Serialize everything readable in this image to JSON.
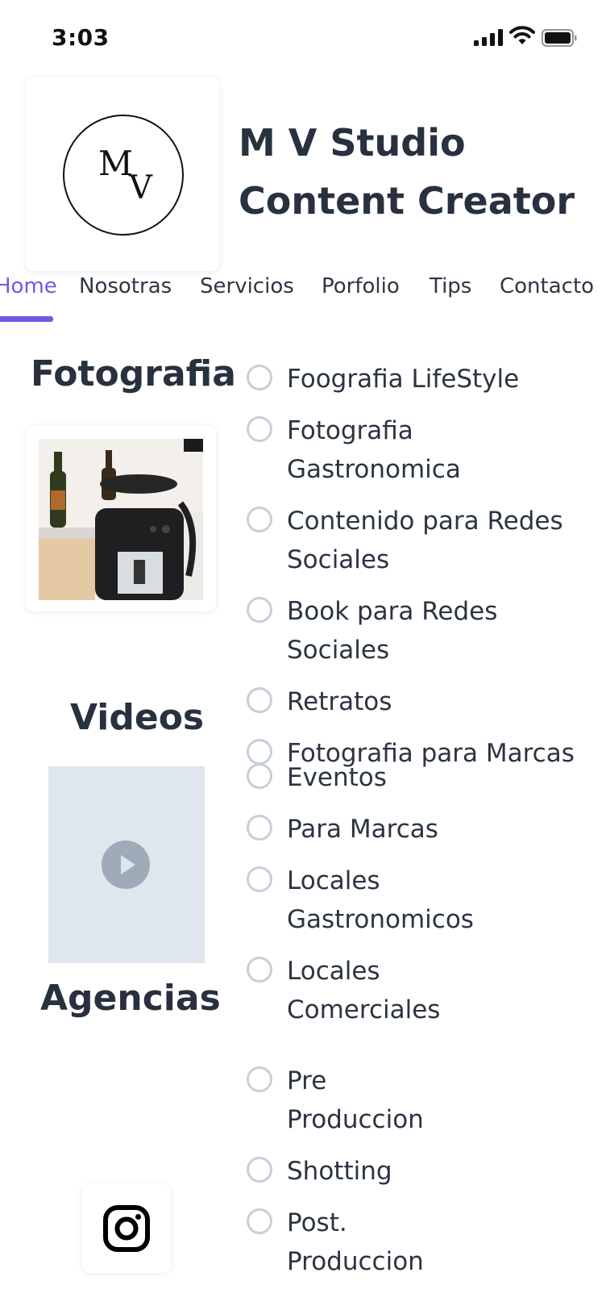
{
  "status_bar": {
    "time": "3:03"
  },
  "header": {
    "logo_letter_m": "M",
    "logo_letter_v": "V",
    "title_line1": "M V Studio",
    "title_line2": "Content Creator"
  },
  "tabs": [
    {
      "label": "Home",
      "active": true
    },
    {
      "label": "Nosotras",
      "active": false
    },
    {
      "label": "Servicios",
      "active": false
    },
    {
      "label": "Porfolio",
      "active": false
    },
    {
      "label": "Tips",
      "active": false
    },
    {
      "label": "Contacto",
      "active": false
    }
  ],
  "sections": {
    "fotografia": "Fotografia",
    "videos": "Videos",
    "agencias": "Agencias"
  },
  "services": [
    {
      "line1": "Foografia LifeStyle",
      "line2": ""
    },
    {
      "line1": "Fotografia",
      "line2": "Gastronomica"
    },
    {
      "line1": "Contenido para Redes",
      "line2": "Sociales"
    },
    {
      "line1": "Book para Redes",
      "line2": "Sociales"
    },
    {
      "line1": "Retratos",
      "line2": ""
    },
    {
      "line1": "Fotografia para Marcas",
      "line2": ""
    },
    {
      "line1": "Eventos",
      "line2": ""
    },
    {
      "line1": "Para Marcas",
      "line2": ""
    },
    {
      "line1": "Locales",
      "line2": "Gastronomicos"
    },
    {
      "line1": "Locales",
      "line2": "Comerciales"
    },
    {
      "line1": "Pre",
      "line2": "Produccion"
    },
    {
      "line1": "Shotting",
      "line2": ""
    },
    {
      "line1": "Post.",
      "line2": "Produccion"
    }
  ],
  "colors": {
    "accent": "#6c5ce7",
    "text": "#2b3441",
    "radio_border": "#c7cfd9",
    "video_placeholder": "#e0e6ee"
  },
  "icons": {
    "play": "play-icon",
    "instagram": "instagram-icon",
    "signal": "cellular-signal-icon",
    "wifi": "wifi-icon",
    "battery": "battery-icon"
  }
}
